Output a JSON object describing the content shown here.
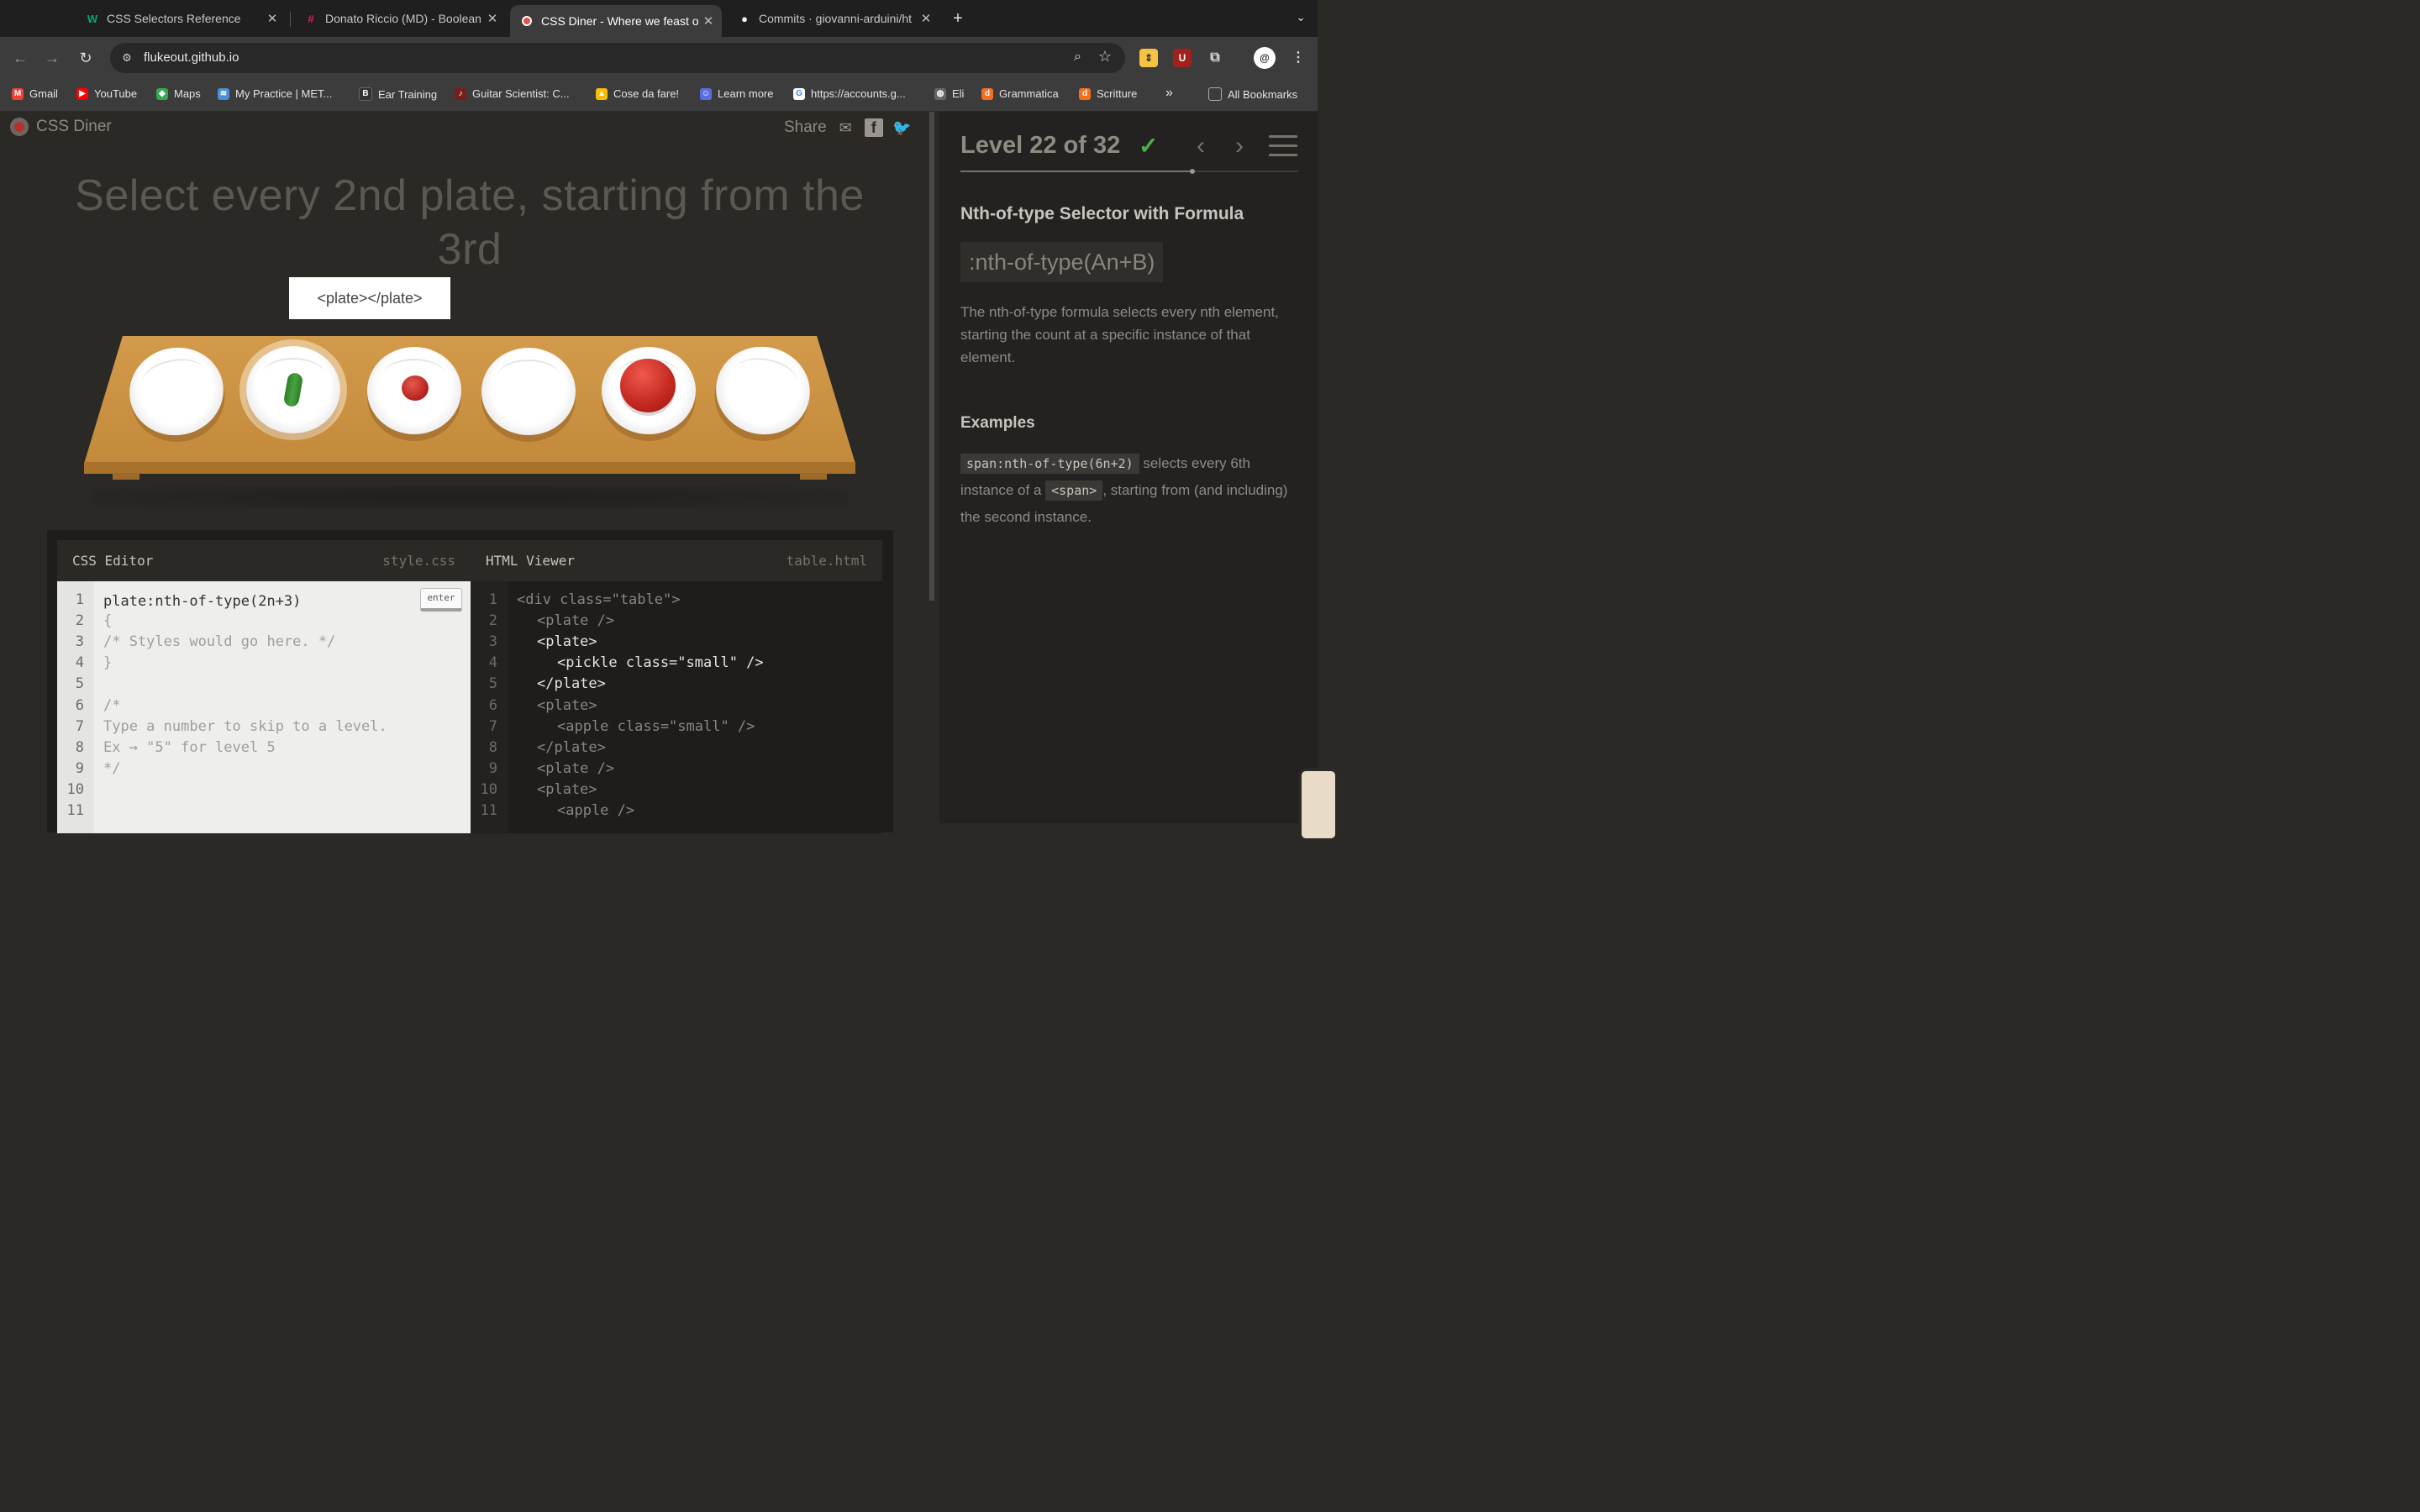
{
  "browser": {
    "tabs": [
      {
        "title": "CSS Selectors Reference",
        "icon": "w3schools-icon",
        "active": false
      },
      {
        "title": "Donato Riccio (MD) - Boolean",
        "icon": "slack-icon",
        "active": false
      },
      {
        "title": "CSS Diner - Where we feast o",
        "icon": "cssdiner-icon",
        "active": true
      },
      {
        "title": "Commits · giovanni-arduini/ht",
        "icon": "github-icon",
        "active": false
      }
    ],
    "new_tab": "+",
    "url": "flukeout.github.io",
    "bookmarks": [
      {
        "label": "Gmail",
        "icon": "gmail-icon"
      },
      {
        "label": "YouTube",
        "icon": "youtube-icon"
      },
      {
        "label": "Maps",
        "icon": "maps-icon"
      },
      {
        "label": "My Practice | MET...",
        "icon": "practice-icon"
      },
      {
        "label": "Ear Training",
        "icon": "eartraining-icon"
      },
      {
        "label": "Guitar Scientist: C...",
        "icon": "guitar-icon"
      },
      {
        "label": "Cose da fare!",
        "icon": "drive-icon"
      },
      {
        "label": "Learn more",
        "icon": "learn-icon"
      },
      {
        "label": "https://accounts.g...",
        "icon": "google-icon"
      },
      {
        "label": "Eli",
        "icon": "globe-icon"
      },
      {
        "label": "Grammatica",
        "icon": "doc-icon"
      },
      {
        "label": "Scritture",
        "icon": "doc-icon"
      }
    ],
    "bookmarks_overflow": "»",
    "all_bookmarks": "All Bookmarks"
  },
  "header": {
    "logo_text": "CSS Diner",
    "share_label": "Share"
  },
  "instruction": "Select every 2nd plate, starting from the 3rd",
  "tooltip": "<plate></plate>",
  "table": {
    "plates": [
      {
        "content": "none",
        "highlighted": false
      },
      {
        "content": "pickle",
        "highlighted": true
      },
      {
        "content": "apple-small",
        "highlighted": false
      },
      {
        "content": "none",
        "highlighted": false
      },
      {
        "content": "apple",
        "highlighted": false
      },
      {
        "content": "none",
        "highlighted": false
      }
    ]
  },
  "css_editor": {
    "title": "CSS Editor",
    "filename": "style.css",
    "input_value": "plate:nth-of-type(2n+3)",
    "enter_label": "enter",
    "line_numbers": [
      "1",
      "2",
      "3",
      "4",
      "5",
      "6",
      "7",
      "8",
      "9",
      "10",
      "11"
    ],
    "lines": [
      "",
      "{",
      "/* Styles would go here. */",
      "}",
      "",
      "/*",
      "Type a number to skip to a level.",
      "Ex → \"5\" for level 5",
      "*/",
      "",
      ""
    ]
  },
  "html_viewer": {
    "title": "HTML Viewer",
    "filename": "table.html",
    "line_numbers": [
      "1",
      "2",
      "3",
      "4",
      "5",
      "6",
      "7",
      "8",
      "9",
      "10",
      "11"
    ],
    "lines": [
      {
        "text": "<div class=\"table\">",
        "indent": 0,
        "hot": false
      },
      {
        "text": "<plate />",
        "indent": 1,
        "hot": false
      },
      {
        "text": "<plate>",
        "indent": 1,
        "hot": true
      },
      {
        "text": "<pickle class=\"small\" />",
        "indent": 2,
        "hot": true
      },
      {
        "text": "</plate>",
        "indent": 1,
        "hot": true
      },
      {
        "text": "<plate>",
        "indent": 1,
        "hot": false
      },
      {
        "text": "<apple class=\"small\" />",
        "indent": 2,
        "hot": false
      },
      {
        "text": "</plate>",
        "indent": 1,
        "hot": false
      },
      {
        "text": "<plate />",
        "indent": 1,
        "hot": false
      },
      {
        "text": "<plate>",
        "indent": 1,
        "hot": false
      },
      {
        "text": "<apple />",
        "indent": 2,
        "hot": false
      }
    ]
  },
  "sidebar": {
    "level_title": "Level 22 of 32",
    "completed_mark": "✓",
    "level_current": 22,
    "level_total": 32,
    "prev_label": "‹",
    "next_label": "›",
    "selector_name": "Nth-of-type Selector with Formula",
    "syntax": ":nth-of-type(An+B)",
    "description": "The nth-of-type formula selects every nth element, starting the count at a specific instance of that element.",
    "examples_heading": "Examples",
    "example": {
      "code1": "span:nth-of-type(6n+2)",
      "text1": " selects every 6th instance of a ",
      "code2": "<span>",
      "text2": ", starting from (and including) the second instance."
    }
  },
  "colors": {
    "page_bg": "#2b2926",
    "sidebar_bg": "#232220",
    "check_green": "#4caf50",
    "table_wood": "#d29a4a",
    "apple_red": "#c32720",
    "pickle_green": "#49a23f"
  }
}
